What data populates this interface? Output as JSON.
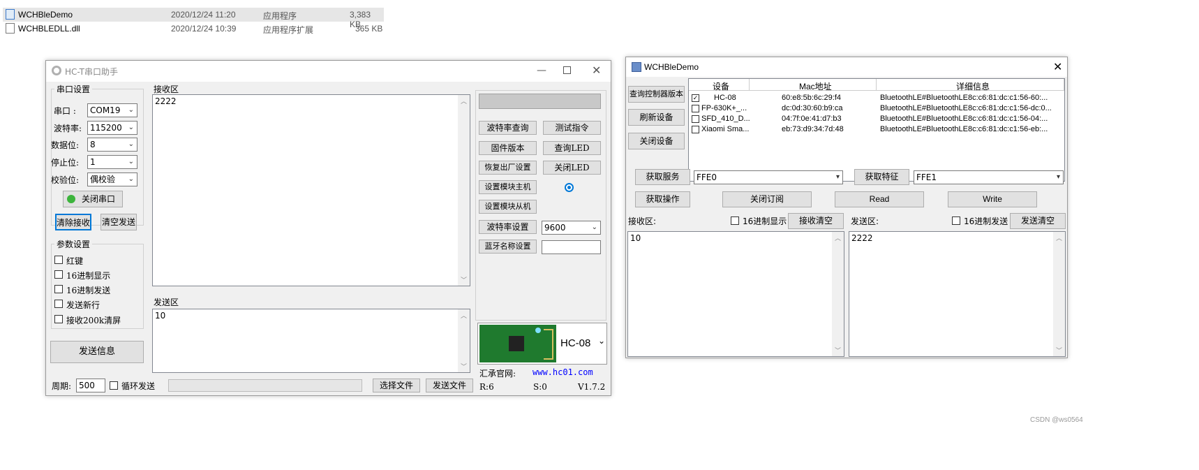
{
  "explorer": {
    "files": [
      {
        "name": "WCHBleDemo",
        "date": "2020/12/24 11:20",
        "type": "应用程序",
        "size": "3,383 KB",
        "selected": true
      },
      {
        "name": "WCHBLEDLL.dll",
        "date": "2020/12/24 10:39",
        "type": "应用程序扩展",
        "size": "365 KB",
        "selected": false
      }
    ]
  },
  "hc": {
    "title": "HC-T串口助手",
    "serial_group": "串口设置",
    "port_label": "串口  :",
    "port_value": "COM19",
    "baud_label": "波特率:",
    "baud_value": "115200",
    "databits_label": "数据位:",
    "databits_value": "8",
    "stopbits_label": "停止位:",
    "stopbits_value": "1",
    "parity_label": "校验位:",
    "parity_value": "偶校验",
    "close_port": "关闭串口",
    "clear_recv": "清除接收",
    "clear_send": "清空发送",
    "params_group": "参数设置",
    "options": [
      "红键",
      "16进制显示",
      "16进制发送",
      "发送新行",
      "接收200k清屏"
    ],
    "send_info": "发送信息",
    "recv_label": "接收区",
    "recv_text": "2222",
    "send_label": "发送区",
    "send_text": "10",
    "period_label": "周期:",
    "period_value": "500",
    "loop_label": "循环发送",
    "choose_file": "选择文件",
    "send_file": "发送文件",
    "at_buttons": {
      "baud_query": "波特率查询",
      "test_cmd": "测试指令",
      "firmware": "固件版本",
      "query_led": "查询LED",
      "factory": "恢复出厂设置",
      "close_led": "关闭LED",
      "master": "设置模块主机",
      "slave": "设置模块从机",
      "baud_set": "波特率设置",
      "bt_name": "蓝牙名称设置"
    },
    "baud_set_value": "9600",
    "module_name": "HC-08",
    "site_label": "汇承官网:",
    "site_url": "www.hc01.com",
    "status_r": "R:6",
    "status_s": "S:0",
    "version": "V1.7.2"
  },
  "wch": {
    "title": "WCHBleDemo",
    "btn_query_version": "查询控制器版本",
    "btn_refresh": "刷新设备",
    "btn_close_dev": "关闭设备",
    "columns": [
      "设备",
      "Mac地址",
      "详细信息"
    ],
    "devices": [
      {
        "checked": true,
        "name": "HC-08",
        "mac": "60:e8:5b:6c:29:f4",
        "info": "BluetoothLE#BluetoothLE8c:c6:81:dc:c1:56-60:..."
      },
      {
        "checked": false,
        "name": "FP-630K+_...",
        "mac": "dc:0d:30:60:b9:ca",
        "info": "BluetoothLE#BluetoothLE8c:c6:81:dc:c1:56-dc:0..."
      },
      {
        "checked": false,
        "name": "SFD_410_D...",
        "mac": "04:7f:0e:41:d7:b3",
        "info": "BluetoothLE#BluetoothLE8c:c6:81:dc:c1:56-04:..."
      },
      {
        "checked": false,
        "name": "Xiaomi Sma...",
        "mac": "eb:73:d9:34:7d:48",
        "info": "BluetoothLE#BluetoothLE8c:c6:81:dc:c1:56-eb:..."
      }
    ],
    "btn_get_service": "获取服务",
    "service_value": "FFE0",
    "btn_get_char": "获取特征",
    "char_value": "FFE1",
    "btn_get_op": "获取操作",
    "btn_unsub": "关闭订阅",
    "btn_read": "Read",
    "btn_write": "Write",
    "recv_label": "接收区:",
    "hex_show": "16进制显示",
    "btn_clear_recv": "接收清空",
    "send_label": "发送区:",
    "hex_send": "16进制发送",
    "btn_clear_send": "发送清空",
    "recv_text": "10",
    "send_text": "2222"
  },
  "watermark": "CSDN @ws0564",
  "colors": {
    "window_bg": "#f0f0f0",
    "accent": "#0078d7",
    "link": "#0000ff"
  }
}
